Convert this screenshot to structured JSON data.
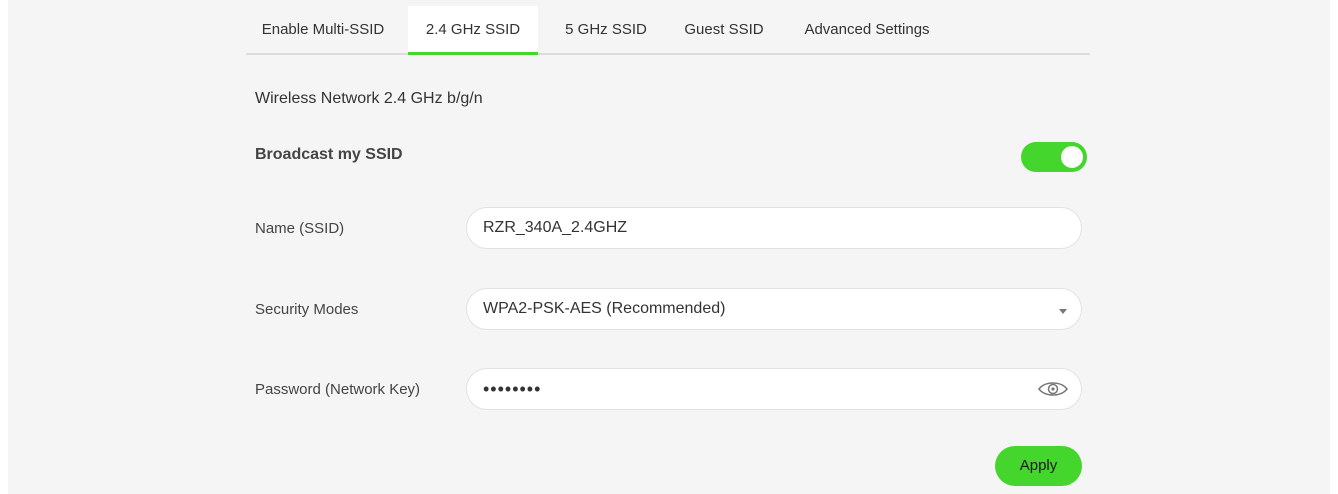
{
  "tabs": [
    {
      "label": "Enable Multi-SSID",
      "active": false
    },
    {
      "label": "2.4 GHz SSID",
      "active": true
    },
    {
      "label": "5 GHz SSID",
      "active": false
    },
    {
      "label": "Guest SSID",
      "active": false
    },
    {
      "label": "Advanced Settings",
      "active": false
    }
  ],
  "section": {
    "title": "Wireless Network 2.4 GHz b/g/n"
  },
  "broadcast": {
    "label": "Broadcast my SSID",
    "enabled": true
  },
  "fields": {
    "ssid": {
      "label": "Name (SSID)",
      "value": "RZR_340A_2.4GHZ"
    },
    "security": {
      "label": "Security Modes",
      "value": "WPA2-PSK-AES (Recommended)"
    },
    "password": {
      "label": "Password (Network Key)",
      "value": "••••••••",
      "icon": "eye-icon"
    }
  },
  "actions": {
    "apply_label": "Apply"
  },
  "colors": {
    "accent": "#44d62c",
    "background": "#f5f5f5",
    "field": "#ffffff"
  }
}
